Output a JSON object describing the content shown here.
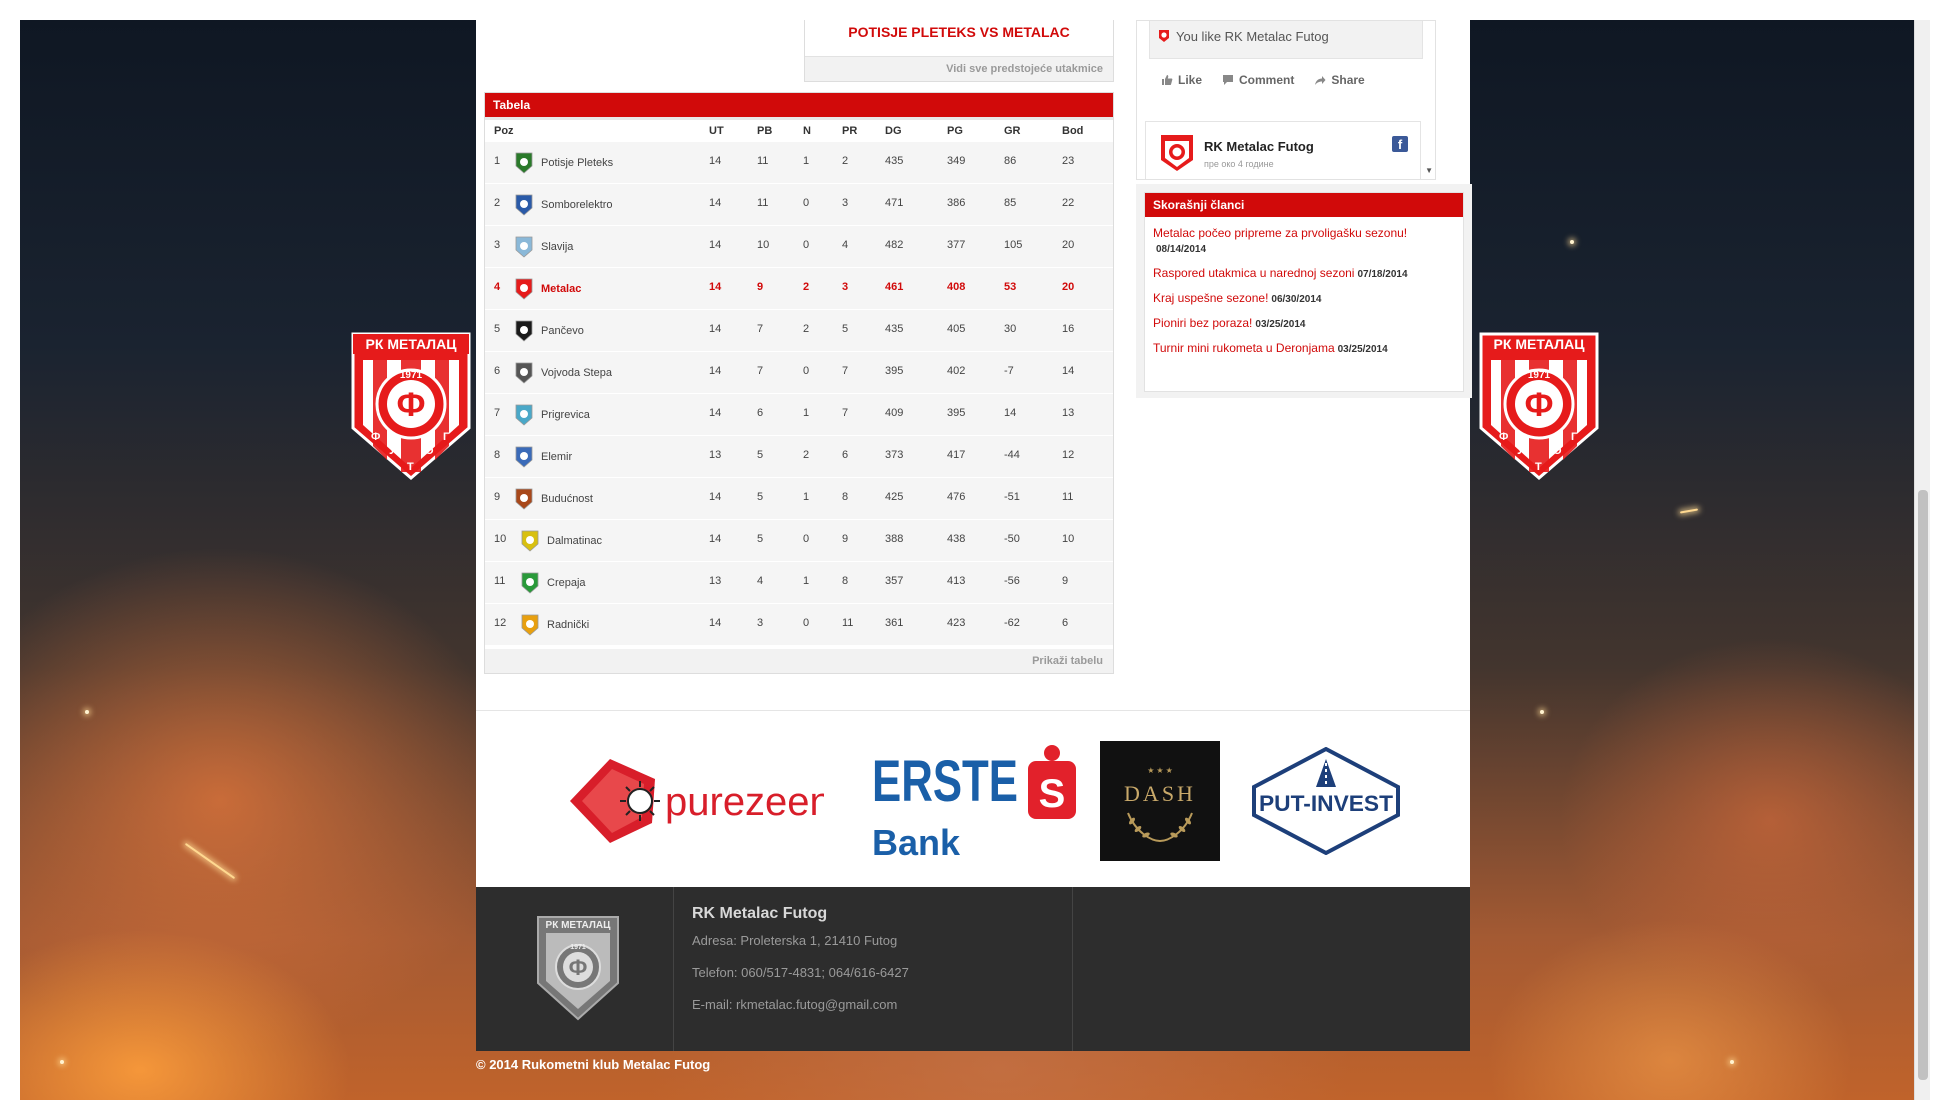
{
  "upcoming": {
    "title": "POTISJE PLETEKS VS METALAC",
    "more_link": "Vidi sve predstojeće utakmice"
  },
  "standings": {
    "title": "Tabela",
    "columns": [
      "Poz",
      "UT",
      "PB",
      "N",
      "PR",
      "DG",
      "PG",
      "GR",
      "Bod"
    ],
    "rows": [
      {
        "pos": "1",
        "team": "Potisje Pleteks",
        "ut": "14",
        "pb": "11",
        "n": "1",
        "pr": "2",
        "dg": "435",
        "pg": "349",
        "gr": "86",
        "bod": "23"
      },
      {
        "pos": "2",
        "team": "Somborelektro",
        "ut": "14",
        "pb": "11",
        "n": "0",
        "pr": "3",
        "dg": "471",
        "pg": "386",
        "gr": "85",
        "bod": "22"
      },
      {
        "pos": "3",
        "team": "Slavija",
        "ut": "14",
        "pb": "10",
        "n": "0",
        "pr": "4",
        "dg": "482",
        "pg": "377",
        "gr": "105",
        "bod": "20"
      },
      {
        "pos": "4",
        "team": "Metalac",
        "ut": "14",
        "pb": "9",
        "n": "2",
        "pr": "3",
        "dg": "461",
        "pg": "408",
        "gr": "53",
        "bod": "20"
      },
      {
        "pos": "5",
        "team": "Pančevo",
        "ut": "14",
        "pb": "7",
        "n": "2",
        "pr": "5",
        "dg": "435",
        "pg": "405",
        "gr": "30",
        "bod": "16"
      },
      {
        "pos": "6",
        "team": "Vojvoda Stepa",
        "ut": "14",
        "pb": "7",
        "n": "0",
        "pr": "7",
        "dg": "395",
        "pg": "402",
        "gr": "-7",
        "bod": "14"
      },
      {
        "pos": "7",
        "team": "Prigrevica",
        "ut": "14",
        "pb": "6",
        "n": "1",
        "pr": "7",
        "dg": "409",
        "pg": "395",
        "gr": "14",
        "bod": "13"
      },
      {
        "pos": "8",
        "team": "Elemir",
        "ut": "13",
        "pb": "5",
        "n": "2",
        "pr": "6",
        "dg": "373",
        "pg": "417",
        "gr": "-44",
        "bod": "12"
      },
      {
        "pos": "9",
        "team": "Budućnost",
        "ut": "14",
        "pb": "5",
        "n": "1",
        "pr": "8",
        "dg": "425",
        "pg": "476",
        "gr": "-51",
        "bod": "11"
      },
      {
        "pos": "10",
        "team": "Dalmatinac",
        "ut": "14",
        "pb": "5",
        "n": "0",
        "pr": "9",
        "dg": "388",
        "pg": "438",
        "gr": "-50",
        "bod": "10"
      },
      {
        "pos": "11",
        "team": "Crepaja",
        "ut": "13",
        "pb": "4",
        "n": "1",
        "pr": "8",
        "dg": "357",
        "pg": "413",
        "gr": "-56",
        "bod": "9"
      },
      {
        "pos": "12",
        "team": "Radnički",
        "ut": "14",
        "pb": "3",
        "n": "0",
        "pr": "11",
        "dg": "361",
        "pg": "423",
        "gr": "-62",
        "bod": "6"
      }
    ],
    "highlight_team": "Metalac",
    "show_table_link": "Prikaži tabelu"
  },
  "facebook": {
    "like_status": "You like RK Metalac Futog",
    "actions": [
      "Like",
      "Comment",
      "Share"
    ],
    "page_name": "RK Metalac Futog",
    "page_time": "пре око 4 године"
  },
  "recent_articles": {
    "title": "Skorašnji članci",
    "items": [
      {
        "title": "Metalac počeo pripreme za prvoligašku sezonu!",
        "date": "08/14/2014"
      },
      {
        "title": "Raspored utakmica u narednoj sezoni",
        "date": "07/18/2014"
      },
      {
        "title": "Kraj uspešne sezone!",
        "date": "06/30/2014"
      },
      {
        "title": "Pioniri bez poraza!",
        "date": "03/25/2014"
      },
      {
        "title": "Turnir mini rukometa u Deronjama",
        "date": "03/25/2014"
      }
    ]
  },
  "sponsors": {
    "purezeen": "purezeen",
    "erste_top": "ERSTE",
    "erste_bottom": "Bank",
    "dash": "DASH",
    "put_invest": "PUT-INVEST"
  },
  "footer": {
    "name": "RK Metalac Futog",
    "address": "Adresa: Proleterska 1, 21410 Futog",
    "phone": "Telefon: 060/517-4831; 064/616-6427",
    "email": "E-mail: rkmetalac.futog@gmail.com",
    "copyright": "© 2014 Rukometni klub Metalac Futog"
  },
  "crest": {
    "top_text": "РК МЕТАЛАЦ",
    "year": "1971",
    "letter": "Ф",
    "bottom_letters": [
      "Ф",
      "У",
      "Т",
      "О",
      "Г"
    ]
  },
  "colors": {
    "accent": "#d10a0a",
    "footer_bg": "#2d2d2d"
  }
}
